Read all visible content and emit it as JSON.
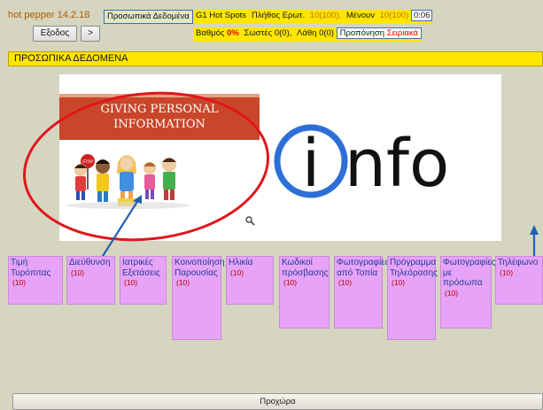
{
  "header": {
    "app_title": "hot pepper 14.2.18",
    "topic": "Προσωπικά Δεδομένα",
    "game_mode": "G1 Hot Spots",
    "questions_label": "Πλήθος Ερωτ.",
    "questions_count": "10(100),",
    "remaining_label": "Μένουν",
    "remaining_count": "10(100)",
    "timer": "0:06",
    "score_label": "Βαθμός",
    "score_value": "0%",
    "correct_label": "Σωστές",
    "correct_value": "0(0),",
    "wrong_label": "Λάθη",
    "wrong_value": "0(0)",
    "mode_label": "Προπόνηση",
    "mode_value": "Σειριακά"
  },
  "buttons": {
    "exit": "Εξοδος",
    "next_small": ">",
    "next": "Προχώρα"
  },
  "section_title": "ΠΡΟΣΩΠΙΚΑ ΔΕΔΟΜΕΝΑ",
  "picture": {
    "banner_line1": "GIVING PERSONAL",
    "banner_line2": "INFORMATION",
    "logo_i": "i",
    "logo_rest": "nfo",
    "stop_sign": "STOP"
  },
  "options": [
    {
      "label": "Τιμή Τυρόπιτας",
      "points": "(10)"
    },
    {
      "label": "Διεύθυνση",
      "points": "(10)"
    },
    {
      "label": "Ιατρικές Εξετάσεις",
      "points": "(10)"
    },
    {
      "label": "Κοινοποίηση Παρουσίας",
      "points": "(10)"
    },
    {
      "label": "Ηλικία",
      "points": "(10)"
    },
    {
      "label": "Κωδικοί πρόσβασης",
      "points": "(10)"
    },
    {
      "label": "Φωτογραφίες από Τοπία",
      "points": "(10)"
    },
    {
      "label": "Πρόγραμμα Τηλεόρασης",
      "points": "(10)"
    },
    {
      "label": "Φωτογραφίες με πρόσωπα",
      "points": "(10)"
    },
    {
      "label": "Τηλέφωνο",
      "points": "(10)"
    }
  ],
  "colors": {
    "background": "#d5d5c0",
    "highlight_yellow": "#ffe600",
    "tile": "#e6a3f7",
    "tile_text": "#223c9a",
    "annotation_red": "#e0161b",
    "annotation_blue": "#1f5fb4"
  }
}
